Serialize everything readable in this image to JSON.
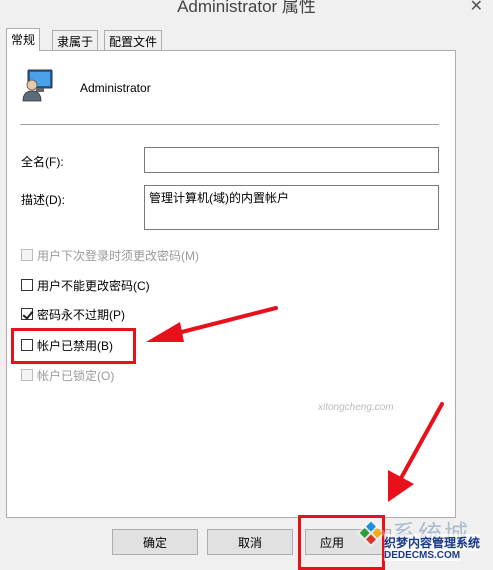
{
  "window": {
    "title": "Administrator 属性"
  },
  "tabs": [
    {
      "label": "常规",
      "active": true
    },
    {
      "label": "隶属于",
      "active": false
    },
    {
      "label": "配置文件",
      "active": false
    }
  ],
  "user": {
    "name": "Administrator"
  },
  "fields": {
    "fullname_label": "全名(F):",
    "fullname_value": "",
    "description_label": "描述(D):",
    "description_value": "管理计算机(域)的内置帐户"
  },
  "checkboxes": [
    {
      "label": "用户下次登录时须更改密码(M)",
      "checked": false,
      "disabled": true
    },
    {
      "label": "用户不能更改密码(C)",
      "checked": false,
      "disabled": false
    },
    {
      "label": "密码永不过期(P)",
      "checked": true,
      "disabled": false
    },
    {
      "label": "帐户已禁用(B)",
      "checked": false,
      "disabled": false
    },
    {
      "label": "帐户已锁定(O)",
      "checked": false,
      "disabled": true
    }
  ],
  "buttons": {
    "ok": "确定",
    "cancel": "取消",
    "apply": "应用"
  },
  "annotations": {
    "highlight_color": "#e8101b"
  },
  "watermark": {
    "brand": "系统城",
    "tagline": "织梦内容管理系统",
    "url": "DEDECMS.COM",
    "domain": "xitongcheng.com"
  }
}
